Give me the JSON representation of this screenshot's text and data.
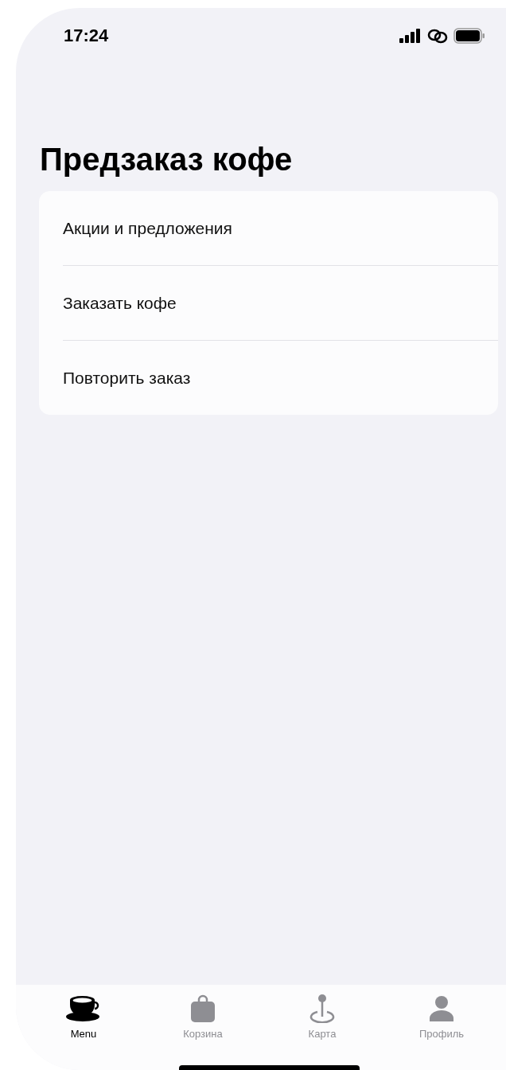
{
  "status_bar": {
    "time": "17:24"
  },
  "title": "Предзаказ кофе",
  "menu_items": [
    "Акции и предложения",
    "Заказать кофе",
    "Повторить заказ"
  ],
  "tab_bar": [
    {
      "label": "Menu",
      "kind": "cup",
      "selected": true
    },
    {
      "label": "Корзина",
      "kind": "bag",
      "selected": false
    },
    {
      "label": "Карта",
      "kind": "pin",
      "selected": false
    },
    {
      "label": "Профиль",
      "kind": "person",
      "selected": false
    }
  ]
}
